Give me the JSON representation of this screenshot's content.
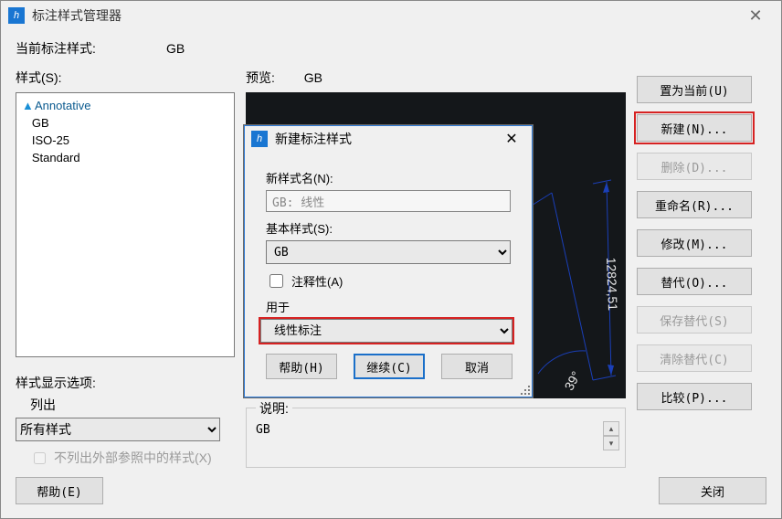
{
  "window": {
    "title": "标注样式管理器",
    "close_glyph": "✕"
  },
  "main": {
    "current_label": "当前标注样式:",
    "current_value": "GB",
    "styles_label": "样式(S):",
    "styles": {
      "annotative": "Annotative",
      "gb": "GB",
      "iso25": "ISO-25",
      "standard": "Standard"
    },
    "display_opts": {
      "title": "样式显示选项:",
      "list_label": "列出",
      "filter_selected": "所有样式",
      "xref_label": "不列出外部参照中的样式(X)"
    },
    "preview_label": "预览:",
    "preview_style": "GB",
    "preview_dims": {
      "right_value": "12824,51",
      "angle_value": "39°"
    },
    "desc": {
      "legend": "说明:",
      "value": "GB"
    },
    "help_btn": "帮助(E)",
    "close_btn": "关闭"
  },
  "buttons": {
    "set_current": "置为当前(U)",
    "new": "新建(N)...",
    "delete": "删除(D)...",
    "rename": "重命名(R)...",
    "modify": "修改(M)...",
    "override": "替代(O)...",
    "save_override": "保存替代(S)",
    "clear_override": "清除替代(C)",
    "compare": "比较(P)..."
  },
  "modal": {
    "title": "新建标注样式",
    "close_glyph": "✕",
    "new_name_label": "新样式名(N):",
    "new_name_value": "GB: 线性",
    "base_label": "基本样式(S):",
    "base_value": "GB",
    "annotative_label": "注释性(A)",
    "use_for_label": "用于",
    "use_for_value": "线性标注",
    "help_btn": "帮助(H)",
    "continue_btn": "继续(C)",
    "cancel_btn": "取消"
  }
}
